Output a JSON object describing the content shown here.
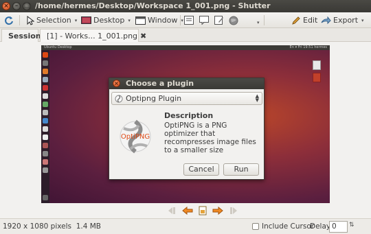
{
  "window": {
    "title": "/home/hermes/Desktop/Workspace 1_001.png - Shutter",
    "close_glyph": "×",
    "min_glyph": "–",
    "max_glyph": "□"
  },
  "toolbar": {
    "refresh_icon": "refresh-icon",
    "selection_label": "Selection",
    "desktop_label": "Desktop",
    "window_label": "Window",
    "edit_label": "Edit",
    "export_label": "Export",
    "caret": "▾"
  },
  "tabs": {
    "session_label": "Session",
    "active_label": "[1] - Works... 1_001.png",
    "close_glyph": "✖"
  },
  "dialog": {
    "title": "Choose a plugin",
    "close_glyph": "×",
    "selected_plugin": "Optipng Plugin",
    "description_heading": "Description",
    "description_text": "OptiPNG is a PNG optimizer that recompresses image files to a smaller size",
    "logo_text": "OptiPNG",
    "cancel_label": "Cancel",
    "run_label": "Run"
  },
  "screenshot_preview": {
    "topbar_left": "Ubuntu Desktop",
    "topbar_right": "En  ▾  Fri 19:51  hermes"
  },
  "statusbar": {
    "dimensions": "1920 x 1080 pixels",
    "size": "1.4 MB",
    "include_cursor_label": "Include Cursor",
    "include_cursor_checked": false,
    "delay_label": "Delay:",
    "delay_value": "0",
    "spin_glyph": "⇅"
  },
  "colors": {
    "accent_orange": "#dd4814",
    "titlebar": "#3c3b37",
    "wallpaper": "#8c2e3a"
  }
}
